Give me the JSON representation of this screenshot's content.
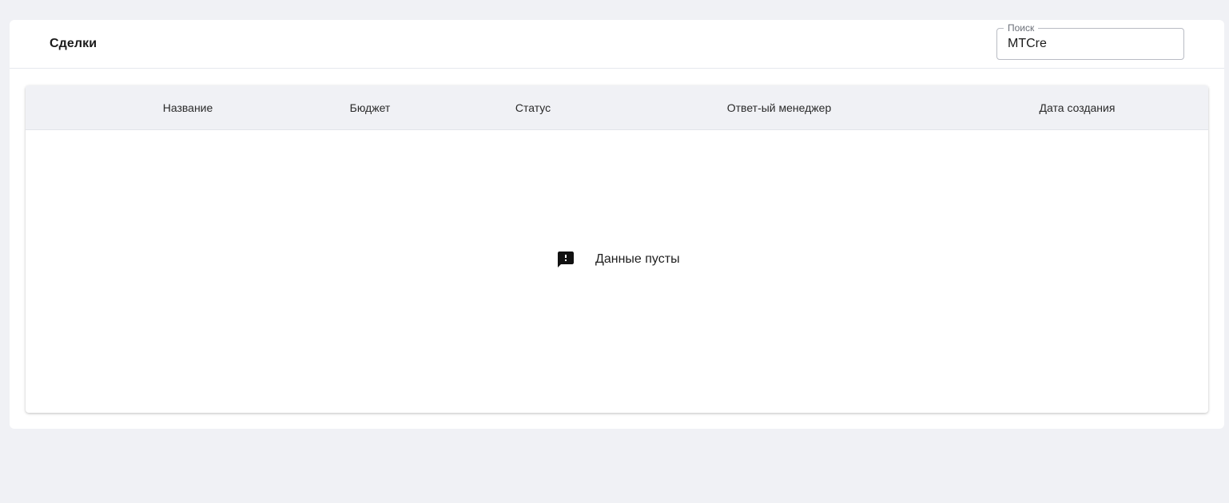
{
  "header": {
    "title": "Сделки"
  },
  "search": {
    "label": "Поиск",
    "value": "MTCre"
  },
  "table": {
    "columns": [
      "Название",
      "Бюджет",
      "Статус",
      "Ответ-ый менеджер",
      "Дата создания"
    ],
    "rows": [],
    "empty": {
      "icon": "feedback-exclamation-icon",
      "message": "Данные пусты"
    }
  },
  "colors": {
    "background": "#f0f1f5",
    "card": "#ffffff",
    "header_row": "#f0f1f5",
    "text": "#1f1f1f"
  }
}
